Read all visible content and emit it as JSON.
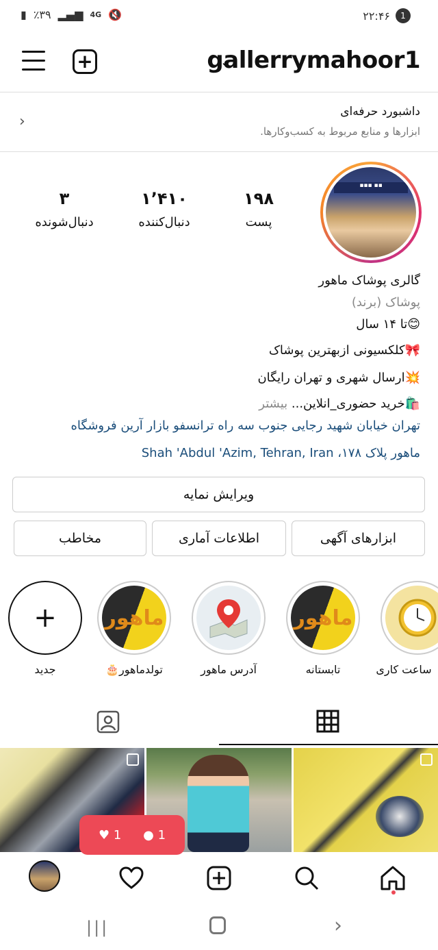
{
  "status_bar": {
    "battery": "٪۳۹",
    "network": "4G",
    "time": "۲۲:۴۶",
    "notification_count": "1"
  },
  "header": {
    "username": "gallerrymahoor1"
  },
  "dashboard": {
    "title": "داشبورد حرفه‌ای",
    "subtitle": "ابزارها و منابع مربوط به کسب‌وکارها."
  },
  "stats": {
    "posts_count": "۱۹۸",
    "posts_label": "پست",
    "followers_count": "۱٬۴۱۰",
    "followers_label": "دنبال‌کننده",
    "following_count": "۳",
    "following_label": "دنبال‌شونده"
  },
  "bio": {
    "name": "گالری پوشاک ماهور",
    "category": "پوشاک (برند)",
    "line1": "😊تا ۱۴ سال",
    "line2": "🎀کلکسیونی ازبهترین پوشاک",
    "line3": "💥ارسال شهری و تهران رایگان",
    "line4": "🛍️خرید حضوری_انلاین...",
    "more": "بیشتر",
    "address_line1": "تهران خیابان شهید رجایی جنوب سه راه ترانسفو بازار آرین فروشگاه",
    "address_line2_fa": "ماهور پلاک ۱۷۸،",
    "address_line2_en": "Shah 'Abdul 'Azim, Tehran, Iran"
  },
  "buttons": {
    "edit_profile": "ویرایش نمایه",
    "ad_tools": "ابزارهای آگهی",
    "insights": "اطلاعات آماری",
    "contact": "مخاطب"
  },
  "highlights": [
    {
      "label": "ساعت کاری"
    },
    {
      "label": "تابستانه"
    },
    {
      "label": "آدرس ماهور"
    },
    {
      "label": "تولدماهور🎂"
    },
    {
      "label": "جدید"
    }
  ],
  "notification_bubble": {
    "likes": "1",
    "comments": "1"
  },
  "colors": {
    "accent_red": "#ed4956",
    "link_blue": "#1a4d7a"
  }
}
